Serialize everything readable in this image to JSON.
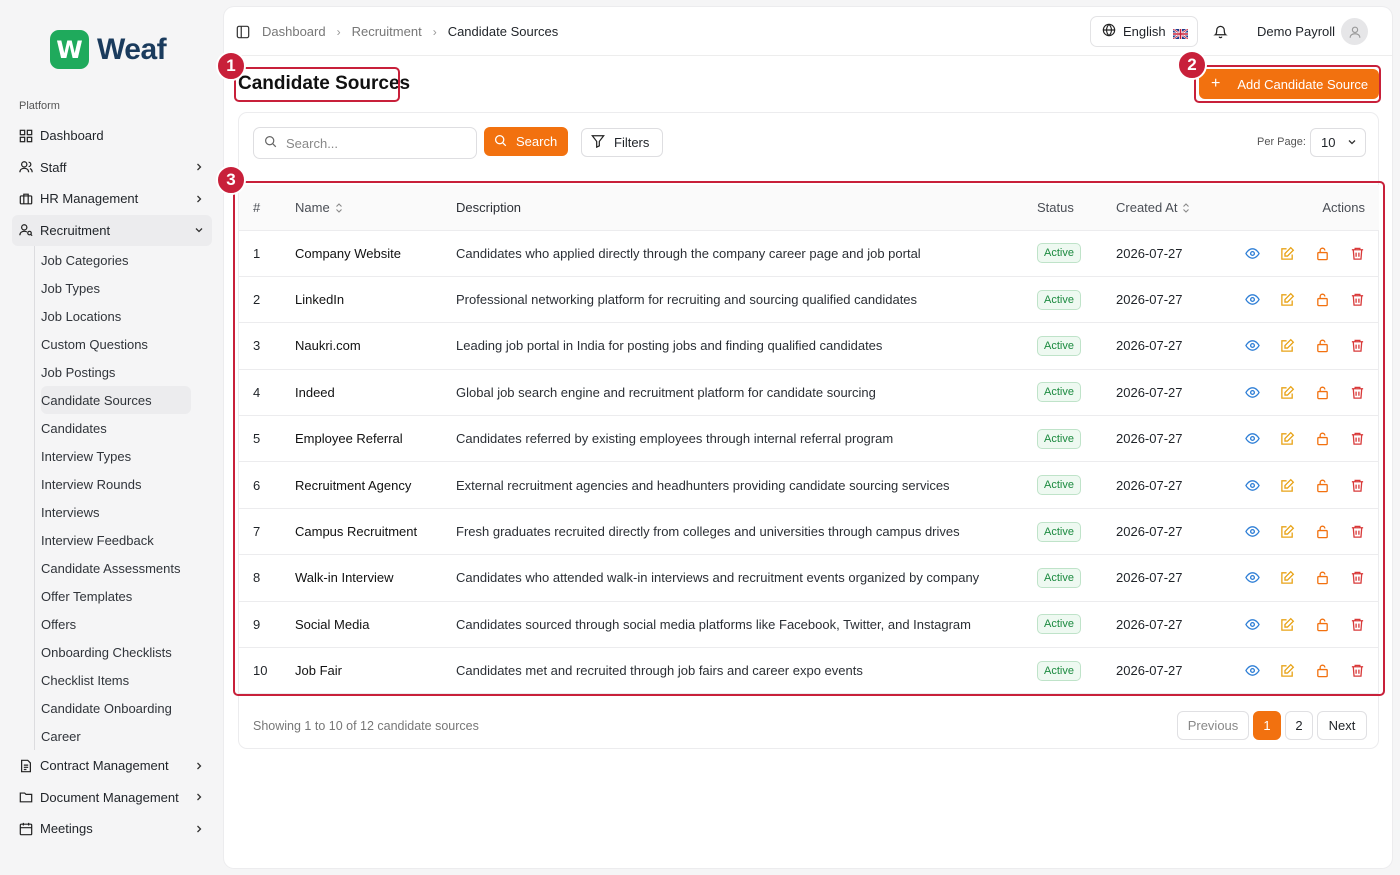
{
  "brand": {
    "logo_letter": "W",
    "name": "Weaf",
    "accent": "#f2710f"
  },
  "sidebar": {
    "section": "Platform",
    "items": [
      {
        "label": "Dashboard",
        "icon": "grid-icon",
        "has_chevron": false
      },
      {
        "label": "Staff",
        "icon": "users-icon",
        "has_chevron": true
      },
      {
        "label": "HR Management",
        "icon": "briefcase-icon",
        "has_chevron": true
      },
      {
        "label": "Recruitment",
        "icon": "user-search-icon",
        "has_chevron": true,
        "open": true
      }
    ],
    "recruitment_sub": [
      "Job Categories",
      "Job Types",
      "Job Locations",
      "Custom Questions",
      "Job Postings",
      "Candidate Sources",
      "Candidates",
      "Interview Types",
      "Interview Rounds",
      "Interviews",
      "Interview Feedback",
      "Candidate Assessments",
      "Offer Templates",
      "Offers",
      "Onboarding Checklists",
      "Checklist Items",
      "Candidate Onboarding",
      "Career"
    ],
    "active_sub": "Candidate Sources",
    "items_after": [
      {
        "label": "Contract Management",
        "icon": "file-icon"
      },
      {
        "label": "Document Management",
        "icon": "folder-icon"
      },
      {
        "label": "Meetings",
        "icon": "calendar-icon"
      }
    ]
  },
  "header": {
    "breadcrumb": [
      "Dashboard",
      "Recruitment",
      "Candidate Sources"
    ],
    "language": "English",
    "user": "Demo Payroll"
  },
  "page": {
    "title": "Candidate Sources",
    "add_button": "Add Candidate Source"
  },
  "toolbar": {
    "search_placeholder": "Search...",
    "search_button": "Search",
    "filters_button": "Filters",
    "per_page_label": "Per Page:",
    "per_page_value": "10"
  },
  "table": {
    "columns": [
      "#",
      "Name",
      "Description",
      "Status",
      "Created At",
      "Actions"
    ],
    "rows": [
      {
        "num": "1",
        "name": "Company Website",
        "desc": "Candidates who applied directly through the company career page and job portal",
        "status": "Active",
        "created": "2026-07-27"
      },
      {
        "num": "2",
        "name": "LinkedIn",
        "desc": "Professional networking platform for recruiting and sourcing qualified candidates",
        "status": "Active",
        "created": "2026-07-27"
      },
      {
        "num": "3",
        "name": "Naukri.com",
        "desc": "Leading job portal in India for posting jobs and finding qualified candidates",
        "status": "Active",
        "created": "2026-07-27"
      },
      {
        "num": "4",
        "name": "Indeed",
        "desc": "Global job search engine and recruitment platform for candidate sourcing",
        "status": "Active",
        "created": "2026-07-27"
      },
      {
        "num": "5",
        "name": "Employee Referral",
        "desc": "Candidates referred by existing employees through internal referral program",
        "status": "Active",
        "created": "2026-07-27"
      },
      {
        "num": "6",
        "name": "Recruitment Agency",
        "desc": "External recruitment agencies and headhunters providing candidate sourcing services",
        "status": "Active",
        "created": "2026-07-27"
      },
      {
        "num": "7",
        "name": "Campus Recruitment",
        "desc": "Fresh graduates recruited directly from colleges and universities through campus drives",
        "status": "Active",
        "created": "2026-07-27"
      },
      {
        "num": "8",
        "name": "Walk-in Interview",
        "desc": "Candidates who attended walk-in interviews and recruitment events organized by company",
        "status": "Active",
        "created": "2026-07-27"
      },
      {
        "num": "9",
        "name": "Social Media",
        "desc": "Candidates sourced through social media platforms like Facebook, Twitter, and Instagram",
        "status": "Active",
        "created": "2026-07-27"
      },
      {
        "num": "10",
        "name": "Job Fair",
        "desc": "Candidates met and recruited through job fairs and career expo events",
        "status": "Active",
        "created": "2026-07-27"
      }
    ]
  },
  "footer": {
    "showing": "Showing 1 to 10 of 12 candidate sources",
    "previous": "Previous",
    "pages": [
      "1",
      "2"
    ],
    "current_page": "1",
    "next": "Next"
  },
  "annotations": [
    "1",
    "2",
    "3"
  ]
}
